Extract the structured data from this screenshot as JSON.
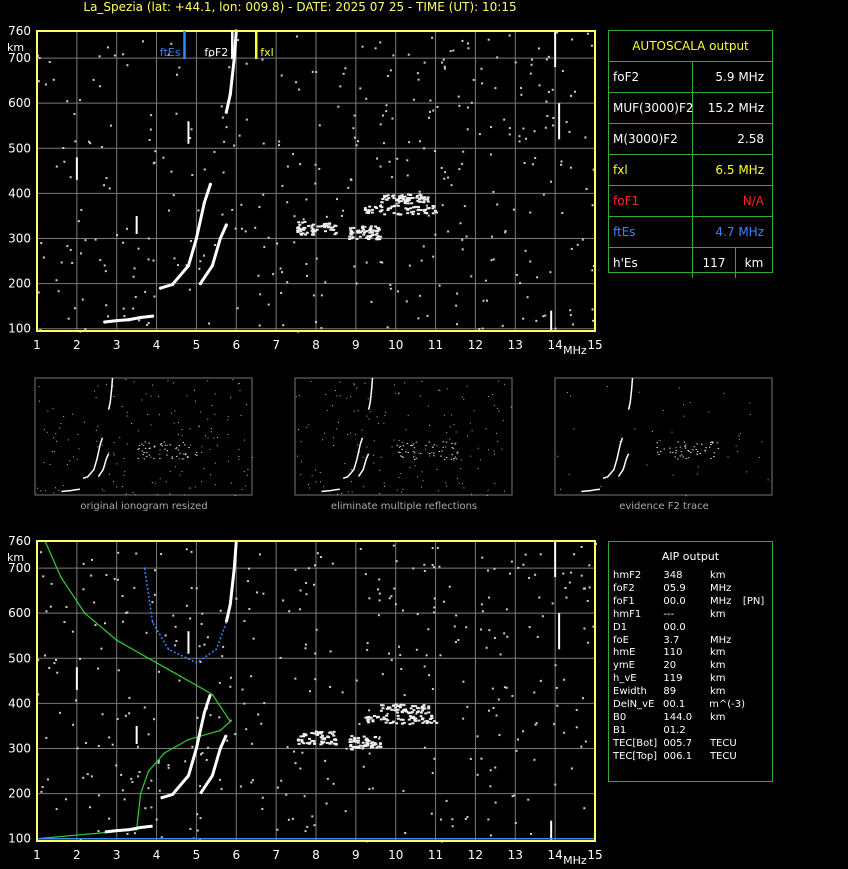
{
  "header": {
    "title": "La_Spezia (lat: +44.1, lon: 009.8) - DATE: 2025 07 25 - TIME (UT): 10:15"
  },
  "colors": {
    "frame": "#ffff66",
    "grid": "#7a7a7a",
    "panel_border": "#33aa33",
    "fxl": "#ffff33",
    "ftEs": "#3388ff",
    "foF1": "#ff2222",
    "echo": "#ffffff",
    "profile": "#33cc33"
  },
  "top_chart": {
    "y_unit": "km",
    "x_unit": "MHz",
    "y_ticks": [
      "100",
      "200",
      "300",
      "400",
      "500",
      "600",
      "700",
      "760"
    ],
    "x_ticks": [
      "1",
      "2",
      "3",
      "4",
      "5",
      "6",
      "7",
      "8",
      "9",
      "10",
      "11",
      "12",
      "13",
      "14",
      "15"
    ],
    "markers": [
      {
        "label": "ftEs",
        "freq": 4.7,
        "color": "#3388ff"
      },
      {
        "label": "foF2",
        "freq": 5.9,
        "color": "#ffffff"
      },
      {
        "label": "fxl",
        "freq": 6.5,
        "color": "#ffff33"
      }
    ]
  },
  "autoscala": {
    "title": "AUTOSCALA output",
    "rows": [
      {
        "key": "foF2",
        "value": "5.9 MHz",
        "color": "#ffffff"
      },
      {
        "key": "MUF(3000)F2",
        "value": "15.2 MHz",
        "color": "#ffffff"
      },
      {
        "key": "M(3000)F2",
        "value": "2.58",
        "color": "#ffffff"
      },
      {
        "key": "fxl",
        "value": "6.5 MHz",
        "color": "#ffff33"
      },
      {
        "key": "foF1",
        "value": "N/A",
        "color": "#ff2222"
      },
      {
        "key": "ftEs",
        "value": "4.7 MHz",
        "color": "#3388ff"
      },
      {
        "key": "h'Es",
        "value": "117",
        "unit": "km",
        "color": "#ffffff"
      }
    ]
  },
  "thumbnails": {
    "captions": [
      "original ionogram resized",
      "eliminate multiple reflections",
      "evidence F2 trace"
    ]
  },
  "aip": {
    "title": "AIP output",
    "rows": [
      [
        "hmF2",
        "348",
        "km",
        ""
      ],
      [
        "foF2",
        "05.9",
        "MHz",
        ""
      ],
      [
        "foF1",
        "00.0",
        "MHz",
        "[PN]"
      ],
      [
        "hmF1",
        "---",
        "km",
        ""
      ],
      [
        "D1",
        "00.0",
        "",
        ""
      ],
      [
        "foE",
        "3.7",
        "MHz",
        ""
      ],
      [
        "hmE",
        "110",
        "km",
        ""
      ],
      [
        "ymE",
        "20",
        "km",
        ""
      ],
      [
        "h_vE",
        "119",
        "km",
        ""
      ],
      [
        "Ewidth",
        "89",
        "km",
        ""
      ],
      [
        "DelN_vE",
        "00.1",
        "m^(-3)",
        ""
      ],
      [
        "B0",
        "144.0",
        "km",
        ""
      ],
      [
        "B1",
        "01.2",
        "",
        ""
      ],
      [
        "TEC[Bot]",
        "005.7",
        "TECU",
        ""
      ],
      [
        "TEC[Top]",
        "006.1",
        "TECU",
        ""
      ]
    ]
  },
  "chart_data": [
    {
      "type": "scatter",
      "name": "ionogram",
      "xlim": [
        1,
        15
      ],
      "ylim": [
        95,
        760
      ],
      "ylabel": "km",
      "xlabel": "MHz",
      "grid": true,
      "series": [
        {
          "name": "E/Es trace",
          "points": [
            [
              2.7,
              115
            ],
            [
              3.0,
              118
            ],
            [
              3.3,
              120
            ],
            [
              3.6,
              125
            ],
            [
              3.9,
              128
            ]
          ]
        },
        {
          "name": "F2 o-trace",
          "points": [
            [
              4.1,
              190
            ],
            [
              4.4,
              198
            ],
            [
              4.8,
              240
            ],
            [
              5.0,
              300
            ],
            [
              5.2,
              380
            ],
            [
              5.35,
              420
            ]
          ]
        },
        {
          "name": "F2 x-trace",
          "points": [
            [
              5.1,
              200
            ],
            [
              5.4,
              240
            ],
            [
              5.6,
              300
            ],
            [
              5.75,
              330
            ]
          ]
        },
        {
          "name": "F2 upper",
          "points": [
            [
              5.75,
              580
            ],
            [
              5.85,
              620
            ],
            [
              5.95,
              700
            ],
            [
              6.0,
              760
            ]
          ]
        }
      ]
    },
    {
      "type": "line",
      "name": "AIP profile",
      "xlim": [
        1,
        15
      ],
      "ylim": [
        95,
        760
      ],
      "grid": true,
      "series": [
        {
          "name": "electron density profile",
          "points": [
            [
              1.2,
              760
            ],
            [
              1.6,
              680
            ],
            [
              2.2,
              600
            ],
            [
              3.0,
              540
            ],
            [
              3.8,
              500
            ],
            [
              4.6,
              460
            ],
            [
              5.4,
              420
            ],
            [
              5.85,
              360
            ],
            [
              5.6,
              340
            ],
            [
              4.8,
              320
            ],
            [
              4.2,
              290
            ],
            [
              3.8,
              250
            ],
            [
              3.6,
              200
            ],
            [
              3.55,
              160
            ],
            [
              3.5,
              120
            ],
            [
              1.0,
              100
            ]
          ]
        },
        {
          "name": "virtual height fit",
          "points": [
            [
              3.7,
              700
            ],
            [
              3.9,
              580
            ],
            [
              4.3,
              520
            ],
            [
              5.0,
              490
            ],
            [
              5.5,
              520
            ],
            [
              5.75,
              580
            ]
          ]
        }
      ]
    }
  ]
}
